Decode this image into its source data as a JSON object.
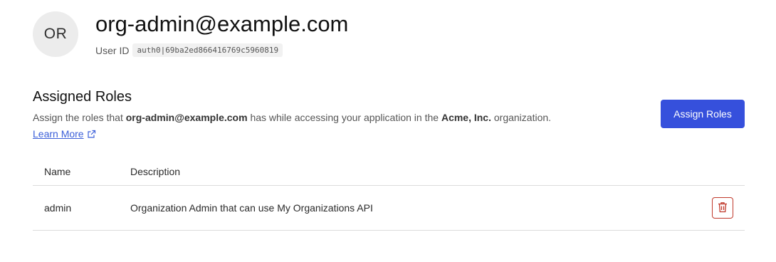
{
  "user": {
    "avatar_initials": "OR",
    "email": "org-admin@example.com",
    "id_label": "User ID",
    "id_value": "auth0|69ba2ed866416769c5960819"
  },
  "roles_section": {
    "title": "Assigned Roles",
    "desc_prefix": "Assign the roles that ",
    "desc_user": "org-admin@example.com",
    "desc_middle": " has while accessing your application in the ",
    "desc_org": "Acme, Inc.",
    "desc_suffix": " organization.",
    "learn_more_label": "Learn More",
    "assign_button_label": "Assign Roles"
  },
  "table": {
    "columns": [
      "Name",
      "Description"
    ],
    "rows": [
      {
        "name": "admin",
        "description": "Organization Admin that can use My Organizations API"
      }
    ]
  },
  "colors": {
    "accent": "#3650dc",
    "link": "#3b5fd9",
    "danger": "#c0392b"
  },
  "icons": {
    "external_link": "external-link-icon",
    "delete": "trash-icon"
  }
}
